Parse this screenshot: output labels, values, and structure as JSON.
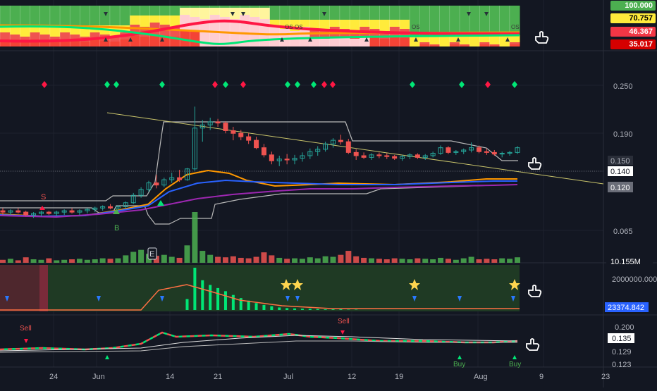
{
  "colors": {
    "background": "#131722",
    "bull": "#26a69a",
    "bear": "#ef5350",
    "vol_bull": "#4caf50",
    "vol_bear": "#ef5350",
    "ema_orange": "#ff9800",
    "ema_blue": "#2962ff",
    "ema_purple": "#9c27b0",
    "trendline": "#c9c46b",
    "channel": "#b8b8b8",
    "signal_green": "#00e676",
    "signal_red": "#ff1744"
  },
  "icons": [
    "hand-pointer-icon"
  ],
  "heatmap_panel": {
    "scale_labels": [
      {
        "text": "100.000",
        "bg": "#4caf50",
        "fg": "#ffffff"
      },
      {
        "text": "70.757",
        "bg": "#ffeb3b",
        "fg": "#000000"
      },
      {
        "text": "46.367",
        "bg": "#f23645",
        "fg": "#ffffff"
      },
      {
        "text": "35.017",
        "bg": "#d50000",
        "fg": "#ffffff"
      }
    ],
    "marks": [
      "OS",
      "OS",
      "OS",
      "OS"
    ]
  },
  "price_panel": {
    "tick_labels": [
      "0.250",
      "0.190",
      "0.150",
      "0.140",
      "0.120",
      "0.065"
    ],
    "last_price": "0.140",
    "volume_label": "10.155M",
    "markers": {
      "sell": "S",
      "buy": "B",
      "earnings": "E"
    }
  },
  "volume_osc_panel": {
    "tick_label": "2000000.000",
    "value_label": "23374.842"
  },
  "signal_panel": {
    "tick_labels": [
      "0.200",
      "0.135",
      "0.129",
      "0.123"
    ],
    "labels": [
      "Sell",
      "Sell",
      "Buy",
      "Buy"
    ]
  },
  "x_axis": {
    "labels": [
      "24",
      "Jun",
      "14",
      "21",
      "Jul",
      "12",
      "19",
      "Aug",
      "9",
      "23"
    ]
  },
  "chart_data": {
    "type": "candlestick",
    "x_axis_ticks": [
      "24",
      "Jun",
      "14",
      "21",
      "Jul",
      "12",
      "19",
      "Aug",
      "9",
      "23"
    ],
    "y_axis_ticks": [
      0.065,
      0.12,
      0.14,
      0.15,
      0.19,
      0.25
    ],
    "last_price": 0.14,
    "ohlc": [
      [
        0.078,
        0.08,
        0.075,
        0.077
      ],
      [
        0.077,
        0.079,
        0.075,
        0.078
      ],
      [
        0.078,
        0.08,
        0.076,
        0.077
      ],
      [
        0.077,
        0.078,
        0.074,
        0.075
      ],
      [
        0.075,
        0.077,
        0.073,
        0.076
      ],
      [
        0.076,
        0.078,
        0.074,
        0.077
      ],
      [
        0.077,
        0.078,
        0.075,
        0.076
      ],
      [
        0.076,
        0.078,
        0.074,
        0.077
      ],
      [
        0.077,
        0.079,
        0.075,
        0.078
      ],
      [
        0.078,
        0.08,
        0.076,
        0.077
      ],
      [
        0.077,
        0.079,
        0.075,
        0.078
      ],
      [
        0.078,
        0.08,
        0.076,
        0.079
      ],
      [
        0.079,
        0.081,
        0.077,
        0.08
      ],
      [
        0.08,
        0.082,
        0.078,
        0.081
      ],
      [
        0.081,
        0.083,
        0.079,
        0.08
      ],
      [
        0.08,
        0.082,
        0.078,
        0.081
      ],
      [
        0.081,
        0.085,
        0.08,
        0.084
      ],
      [
        0.084,
        0.092,
        0.083,
        0.09
      ],
      [
        0.09,
        0.097,
        0.088,
        0.095
      ],
      [
        0.095,
        0.103,
        0.093,
        0.101
      ],
      [
        0.101,
        0.109,
        0.096,
        0.099
      ],
      [
        0.099,
        0.106,
        0.097,
        0.104
      ],
      [
        0.104,
        0.111,
        0.101,
        0.106
      ],
      [
        0.106,
        0.114,
        0.102,
        0.104
      ],
      [
        0.104,
        0.116,
        0.103,
        0.115
      ],
      [
        0.115,
        0.205,
        0.113,
        0.168
      ],
      [
        0.168,
        0.181,
        0.148,
        0.173
      ],
      [
        0.173,
        0.185,
        0.165,
        0.178
      ],
      [
        0.178,
        0.183,
        0.17,
        0.176
      ],
      [
        0.176,
        0.179,
        0.16,
        0.164
      ],
      [
        0.164,
        0.17,
        0.15,
        0.16
      ],
      [
        0.16,
        0.165,
        0.15,
        0.155
      ],
      [
        0.155,
        0.16,
        0.145,
        0.15
      ],
      [
        0.15,
        0.155,
        0.138,
        0.14
      ],
      [
        0.14,
        0.145,
        0.128,
        0.131
      ],
      [
        0.131,
        0.135,
        0.12,
        0.124
      ],
      [
        0.124,
        0.13,
        0.118,
        0.126
      ],
      [
        0.126,
        0.132,
        0.12,
        0.125
      ],
      [
        0.125,
        0.131,
        0.12,
        0.127
      ],
      [
        0.127,
        0.134,
        0.123,
        0.13
      ],
      [
        0.13,
        0.139,
        0.126,
        0.135
      ],
      [
        0.135,
        0.142,
        0.13,
        0.138
      ],
      [
        0.138,
        0.148,
        0.135,
        0.145
      ],
      [
        0.145,
        0.153,
        0.14,
        0.15
      ],
      [
        0.15,
        0.158,
        0.144,
        0.148
      ],
      [
        0.148,
        0.152,
        0.132,
        0.134
      ],
      [
        0.134,
        0.138,
        0.125,
        0.13
      ],
      [
        0.13,
        0.134,
        0.126,
        0.128
      ],
      [
        0.128,
        0.133,
        0.125,
        0.131
      ],
      [
        0.131,
        0.134,
        0.127,
        0.13
      ],
      [
        0.13,
        0.133,
        0.126,
        0.129
      ],
      [
        0.129,
        0.131,
        0.125,
        0.127
      ],
      [
        0.127,
        0.131,
        0.124,
        0.129
      ],
      [
        0.129,
        0.133,
        0.126,
        0.131
      ],
      [
        0.131,
        0.133,
        0.126,
        0.128
      ],
      [
        0.128,
        0.132,
        0.125,
        0.13
      ],
      [
        0.13,
        0.135,
        0.128,
        0.133
      ],
      [
        0.133,
        0.143,
        0.131,
        0.14
      ],
      [
        0.14,
        0.142,
        0.132,
        0.134
      ],
      [
        0.134,
        0.137,
        0.131,
        0.135
      ],
      [
        0.135,
        0.139,
        0.132,
        0.137
      ],
      [
        0.137,
        0.147,
        0.134,
        0.14
      ],
      [
        0.14,
        0.143,
        0.133,
        0.135
      ],
      [
        0.135,
        0.139,
        0.131,
        0.134
      ],
      [
        0.134,
        0.137,
        0.13,
        0.132
      ],
      [
        0.132,
        0.135,
        0.128,
        0.133
      ],
      [
        0.133,
        0.136,
        0.13,
        0.134
      ],
      [
        0.134,
        0.142,
        0.132,
        0.14
      ]
    ],
    "volume": [
      0.6,
      0.8,
      0.5,
      1.1,
      0.7,
      0.6,
      0.9,
      0.5,
      0.6,
      0.7,
      0.8,
      0.6,
      0.7,
      0.9,
      0.8,
      0.9,
      1.5,
      2.2,
      2.6,
      1.8,
      1.4,
      1.6,
      1.2,
      1.0,
      3.5,
      10.2,
      2.4,
      1.6,
      1.2,
      1.1,
      1.3,
      1.0,
      0.9,
      1.2,
      2.1,
      1.5,
      1.0,
      0.8,
      0.9,
      0.8,
      1.1,
      0.9,
      1.3,
      1.2,
      1.6,
      2.4,
      1.3,
      1.0,
      0.9,
      0.8,
      0.7,
      0.9,
      0.8,
      0.7,
      0.9,
      0.8,
      0.7,
      1.0,
      0.8,
      0.6,
      0.9,
      1.2,
      0.7,
      0.8,
      0.7,
      0.9,
      0.8,
      1.1
    ],
    "volume_osc": [
      0,
      0,
      0,
      0,
      0,
      0,
      0,
      0,
      0,
      0,
      0,
      0,
      0,
      0,
      0,
      0,
      0,
      0,
      0,
      0,
      0,
      0,
      0,
      0,
      0.35,
      1.35,
      0.95,
      0.8,
      0.7,
      0.6,
      0.48,
      0.38,
      0.3,
      0.22,
      0.16,
      0.12,
      0.08,
      0.06,
      0.05,
      0.04,
      0.04,
      0.03,
      0.02,
      0.02,
      0.02,
      0.01,
      0.01,
      0,
      0,
      0,
      0,
      0,
      0,
      0,
      0,
      0,
      0,
      0,
      0,
      0,
      0,
      0,
      0,
      0,
      0,
      0,
      0,
      0
    ]
  }
}
